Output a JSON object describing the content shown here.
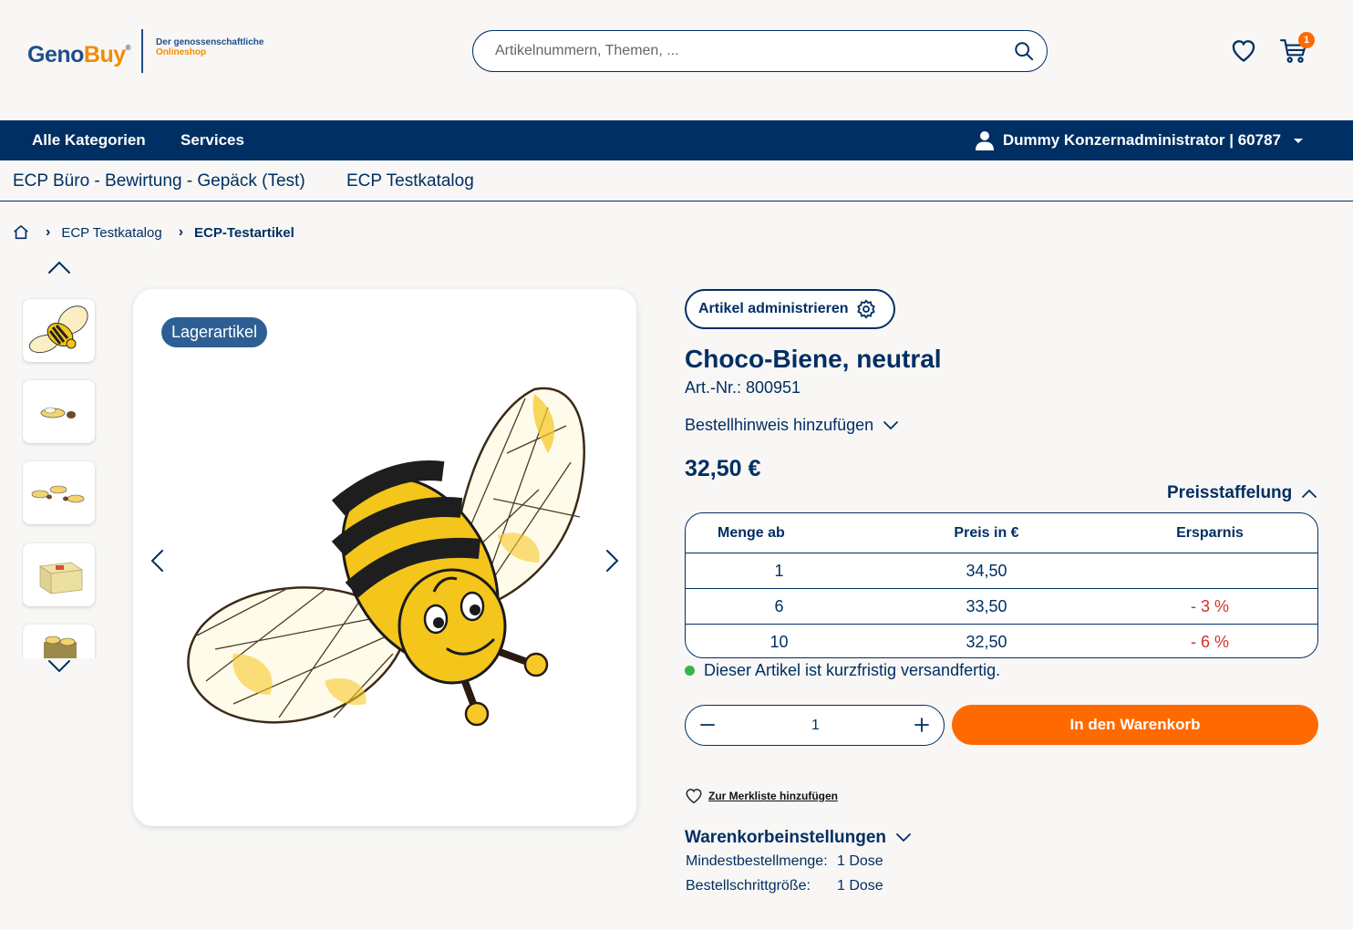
{
  "header": {
    "logo": {
      "part1": "Geno",
      "part2": "Buy",
      "reg": "®",
      "tagline1": "Der genossenschaftliche",
      "tagline2": "Onlineshop"
    },
    "search_placeholder": "Artikelnummern, Themen, ...",
    "cart_count": "1"
  },
  "navbar": {
    "items": [
      "Alle Kategorien",
      "Services"
    ],
    "user": "Dummy Konzernadministrator | 60787"
  },
  "catalog_tabs": [
    "ECP Büro - Bewirtung - Gepäck (Test)",
    "ECP Testkatalog"
  ],
  "breadcrumb": {
    "items": [
      "ECP Testkatalog",
      "ECP-Testartikel"
    ]
  },
  "gallery": {
    "badge": "Lagerartikel"
  },
  "product": {
    "admin_button": "Artikel administrieren",
    "title": "Choco-Biene, neutral",
    "article_number": "Art.-Nr.: 800951",
    "order_note": "Bestellhinweis hinzufügen",
    "price": "32,50 €",
    "tier_toggle": "Preisstaffelung",
    "tier_headers": [
      "Menge ab",
      "Preis in €",
      "Ersparnis"
    ],
    "tiers": [
      {
        "qty": "1",
        "price": "34,50",
        "saving": ""
      },
      {
        "qty": "6",
        "price": "33,50",
        "saving": "- 3 %"
      },
      {
        "qty": "10",
        "price": "32,50",
        "saving": "- 6 %"
      }
    ],
    "stock": "Dieser Artikel ist kurzfristig versandfertig.",
    "quantity": "1",
    "add_to_cart": "In den Warenkorb",
    "wishlist": "Zur Merkliste hinzufügen",
    "cart_settings": "Warenkorbeinstellungen",
    "settings": [
      {
        "label": "Mindestbestellmenge:",
        "value": "1 Dose"
      },
      {
        "label": "Bestellschrittgröße:",
        "value": "1 Dose"
      }
    ]
  },
  "colors": {
    "primary": "#002f63",
    "accent": "#ff6a00",
    "saving": "#d0332c",
    "stock": "#3bb34a"
  }
}
